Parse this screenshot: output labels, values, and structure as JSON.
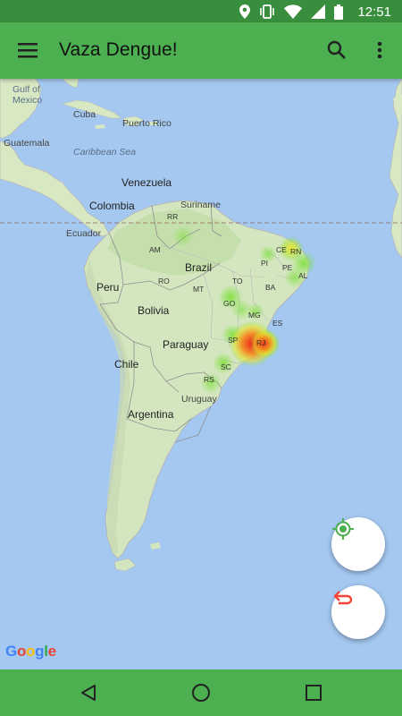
{
  "status_bar": {
    "time": "12:51"
  },
  "app_bar": {
    "title": "Vaza Dengue!"
  },
  "map": {
    "sea_labels": {
      "gulf_line1": "Gulf of",
      "gulf_line2": "Mexico",
      "caribbean": "Caribbean Sea"
    },
    "countries": {
      "cuba": "Cuba",
      "puerto_rico": "Puerto Rico",
      "guatemala": "Guatemala",
      "venezuela": "Venezuela",
      "colombia": "Colombia",
      "suriname": "Suriname",
      "ecuador": "Ecuador",
      "peru": "Peru",
      "brazil": "Brazil",
      "bolivia": "Bolivia",
      "paraguay": "Paraguay",
      "chile": "Chile",
      "argentina": "Argentina",
      "uruguay": "Uruguay"
    },
    "states": {
      "rr": "RR",
      "am": "AM",
      "ce": "CE",
      "rn": "RN",
      "pi": "PI",
      "pe": "PE",
      "al": "AL",
      "ro": "RO",
      "mt": "MT",
      "to": "TO",
      "ba": "BA",
      "go": "GO",
      "mg": "MG",
      "es": "ES",
      "sp": "SP",
      "rj": "RJ",
      "sc": "SC",
      "rs": "RS"
    },
    "attribution": "Google"
  },
  "colors": {
    "primary": "#4caf50",
    "primary_dark": "#388e3c",
    "undo_red": "#f44336",
    "location_green": "#4caf50"
  }
}
